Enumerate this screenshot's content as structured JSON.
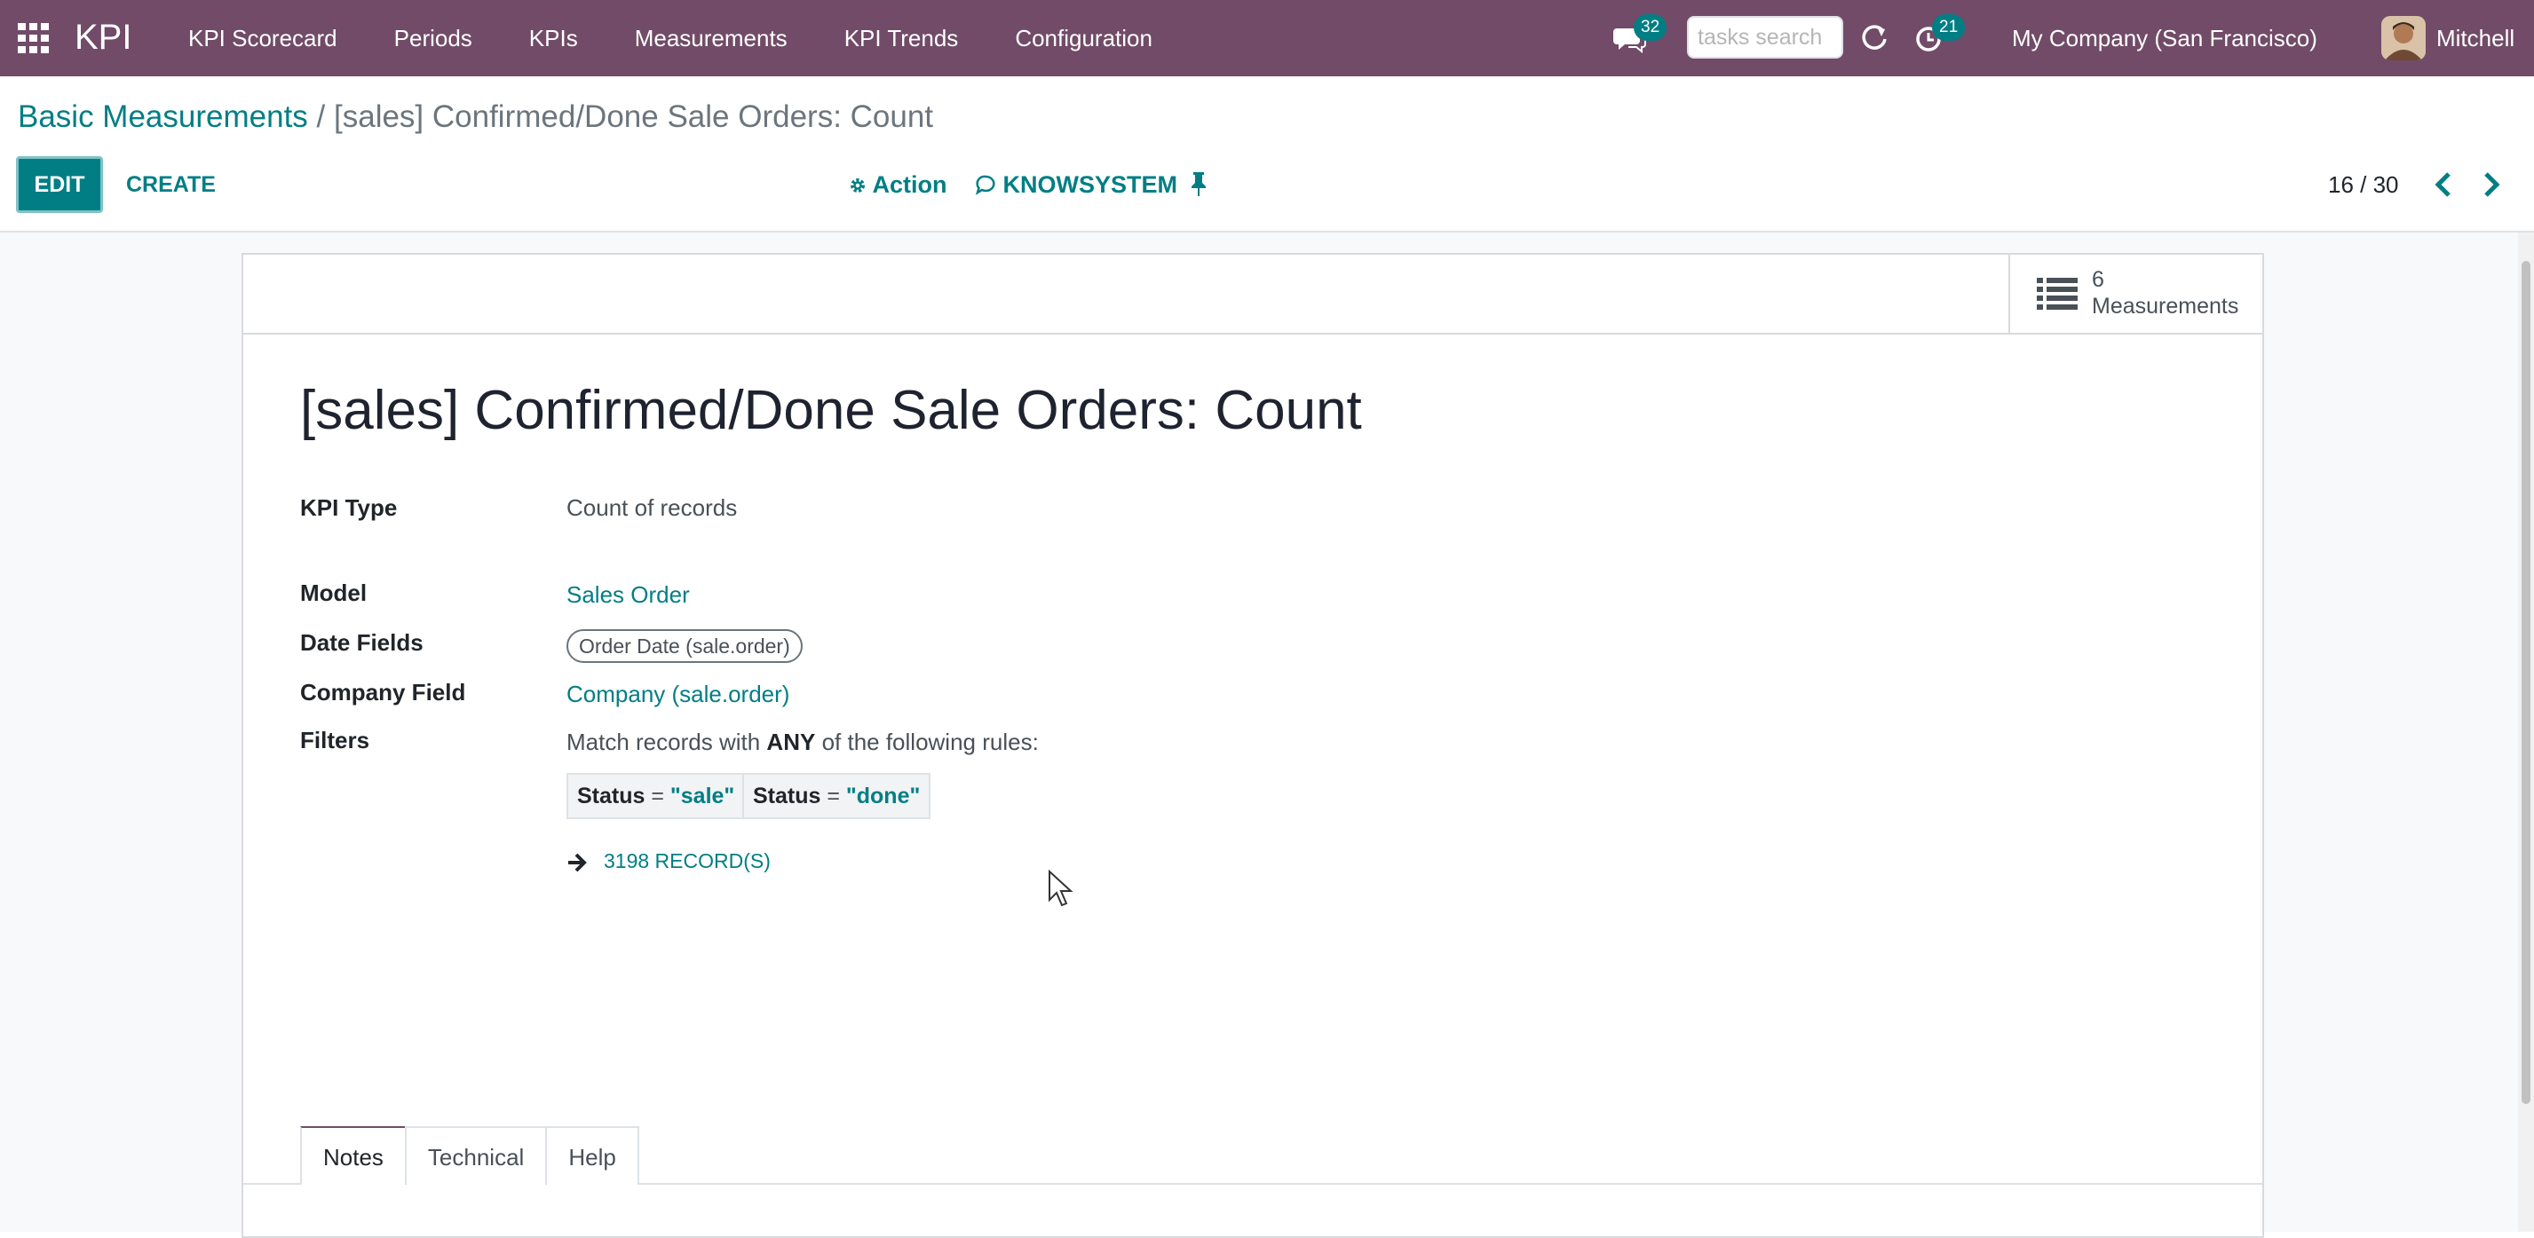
{
  "navbar": {
    "app_name": "KPI",
    "menu": [
      "KPI Scorecard",
      "Periods",
      "KPIs",
      "Measurements",
      "KPI Trends",
      "Configuration"
    ],
    "chat_count": "32",
    "search_placeholder": "tasks search",
    "activity_count": "21",
    "company": "My Company (San Francisco)",
    "user": "Mitchell"
  },
  "breadcrumb": {
    "parent": "Basic Measurements",
    "separator": "/",
    "current": "[sales] Confirmed/Done Sale Orders: Count"
  },
  "toolbar": {
    "edit_label": "EDIT",
    "create_label": "CREATE",
    "action_label": "Action",
    "knowsystem_label": "KNOWSYSTEM",
    "pager": "16 / 30"
  },
  "smart_button": {
    "value": "6",
    "label": "Measurements"
  },
  "record": {
    "title": "[sales] Confirmed/Done Sale Orders: Count",
    "fields": {
      "kpi_type_label": "KPI Type",
      "kpi_type_value": "Count of records",
      "model_label": "Model",
      "model_value": "Sales Order",
      "date_fields_label": "Date Fields",
      "date_fields_tag": "Order Date (sale.order)",
      "company_field_label": "Company Field",
      "company_field_value": "Company (sale.order)",
      "filters_label": "Filters"
    },
    "filters": {
      "intro_prefix": "Match records with",
      "intro_keyword": "ANY",
      "intro_suffix": "of the following rules:",
      "rules": [
        {
          "field": "Status",
          "operator": "=",
          "value": "\"sale\""
        },
        {
          "field": "Status",
          "operator": "=",
          "value": "\"done\""
        }
      ],
      "records_link": "3198 RECORD(S)"
    }
  },
  "tabs": [
    "Notes",
    "Technical",
    "Help"
  ],
  "colors": {
    "navbar": "#714b67",
    "accent": "#017e84",
    "badge": "#017e84"
  }
}
